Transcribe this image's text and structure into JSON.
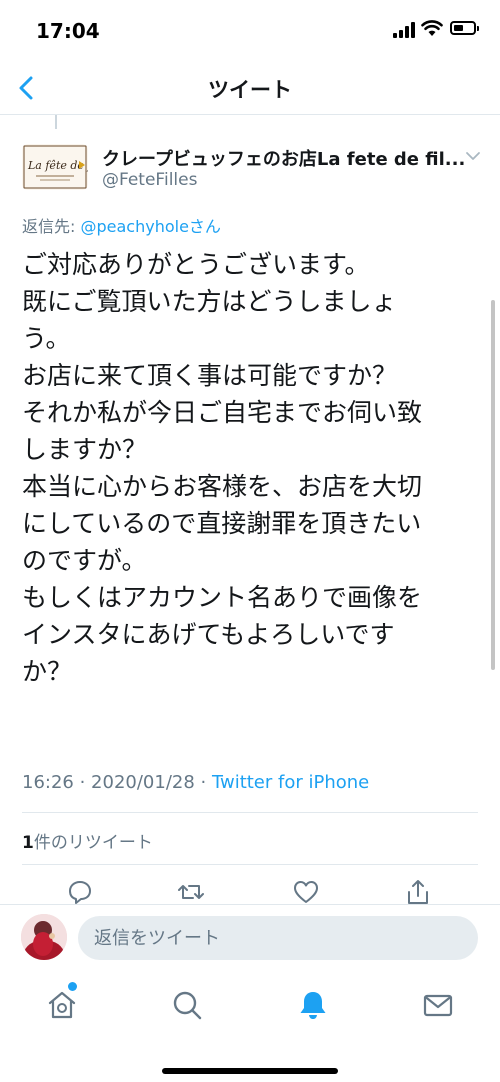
{
  "status_bar": {
    "time": "17:04"
  },
  "nav": {
    "title": "ツイート"
  },
  "tweet": {
    "author_name": "クレープビュッフェのお店La fete de fil...",
    "handle": "@FeteFilles",
    "avatar_logo_text": "La fête de filles",
    "reply_to_prefix": "返信先: ",
    "reply_to_user": "@peachyholeさん",
    "text_lines": [
      "ご対応ありがとうございます。",
      "既にご覧頂いた方はどうしましょ",
      "う。",
      "お店に来て頂く事は可能ですか？",
      "それか私が今日ご自宅までお伺い致",
      "しますか？",
      "本当に心からお客様を、お店を大切",
      "にしているので直接謝罪を頂きたい",
      "のですが。",
      "もしくはアカウント名ありで画像を",
      "インスタにあげてもよろしいです",
      "か？"
    ],
    "timestamp": "16:26 · 2020/01/28 · ",
    "source": "Twitter for iPhone",
    "retweet_count": "1",
    "retweet_label": "件のリツイート"
  },
  "reply_bar": {
    "placeholder": "返信をツイート"
  },
  "icons": {
    "back": "back-chevron-icon",
    "caret": "chevron-down-icon",
    "reply": "reply-icon",
    "retweet": "retweet-icon",
    "like": "heart-icon",
    "share": "share-icon",
    "home": "home-icon",
    "search": "search-icon",
    "notifications": "bell-icon",
    "messages": "mail-icon"
  },
  "colors": {
    "accent": "#1da1f2",
    "secondary_text": "#657786",
    "primary_text": "#14171a"
  }
}
